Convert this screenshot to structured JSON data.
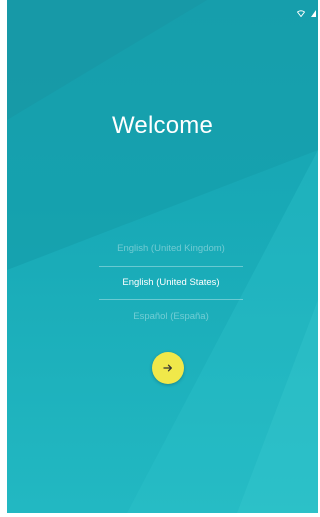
{
  "welcome": {
    "title": "Welcome"
  },
  "languages": [
    {
      "label": "English (United Kingdom)",
      "state": "unselected"
    },
    {
      "label": "English (United States)",
      "state": "selected"
    },
    {
      "label": "Español (España)",
      "state": "unselected"
    }
  ],
  "next_button": {
    "icon": "arrow-right-icon",
    "color": "#f0e84a"
  },
  "status_bar": {
    "icons": [
      "wifi-icon",
      "signal-icon"
    ]
  },
  "colors": {
    "background": "#1aa3b1",
    "accent": "#f0e84a",
    "text": "#ffffff"
  }
}
